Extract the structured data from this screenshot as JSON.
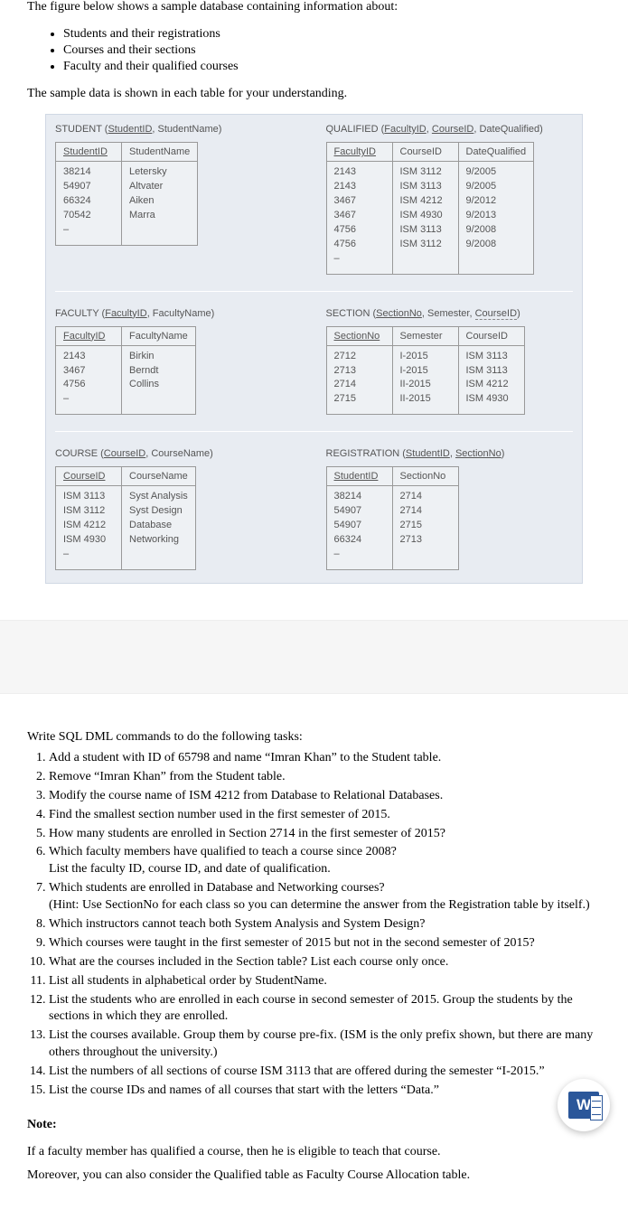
{
  "intro": "The figure below shows a sample database containing information about:",
  "bullets": [
    "Students and their registrations",
    "Courses and their sections",
    "Faculty and their qualified courses"
  ],
  "sample_line": "The sample data is shown in each table for your understanding.",
  "tables": {
    "student": {
      "title_prefix": "STUDENT (",
      "title_pk": "StudentID",
      "title_rest": ", StudentName)",
      "cols": [
        "StudentID",
        "StudentName"
      ],
      "rows": [
        [
          "38214",
          "Letersky"
        ],
        [
          "54907",
          "Altvater"
        ],
        [
          "66324",
          "Aiken"
        ],
        [
          "70542",
          "Marra"
        ],
        [
          "–",
          ""
        ]
      ]
    },
    "qualified": {
      "title_prefix": "QUALIFIED (",
      "title_pk1": "FacultyID",
      "title_sep": ", ",
      "title_pk2": "CourseID",
      "title_rest": ", DateQualified)",
      "cols": [
        "FacultyID",
        "CourseID",
        "DateQualified"
      ],
      "rows": [
        [
          "2143",
          "ISM 3112",
          "9/2005"
        ],
        [
          "2143",
          "ISM 3113",
          "9/2005"
        ],
        [
          "3467",
          "ISM 4212",
          "9/2012"
        ],
        [
          "3467",
          "ISM 4930",
          "9/2013"
        ],
        [
          "4756",
          "ISM 3113",
          "9/2008"
        ],
        [
          "4756",
          "ISM 3112",
          "9/2008"
        ],
        [
          "–",
          "",
          ""
        ]
      ]
    },
    "faculty": {
      "title_prefix": "FACULTY (",
      "title_pk": "FacultyID",
      "title_rest": ", FacultyName)",
      "cols": [
        "FacultyID",
        "FacultyName"
      ],
      "rows": [
        [
          "2143",
          "Birkin"
        ],
        [
          "3467",
          "Berndt"
        ],
        [
          "4756",
          "Collins"
        ],
        [
          "–",
          ""
        ]
      ]
    },
    "section": {
      "title_prefix": "SECTION (",
      "title_pk": "SectionNo",
      "title_mid": ", Semester, ",
      "title_fk": "CourseID",
      "title_rest": ")",
      "cols": [
        "SectionNo",
        "Semester",
        "CourseID"
      ],
      "rows": [
        [
          "2712",
          "I-2015",
          "ISM 3113"
        ],
        [
          "2713",
          "I-2015",
          "ISM 3113"
        ],
        [
          "2714",
          "II-2015",
          "ISM 4212"
        ],
        [
          "2715",
          "II-2015",
          "ISM 4930"
        ]
      ]
    },
    "course": {
      "title_prefix": "COURSE (",
      "title_pk": "CourseID",
      "title_rest": ", CourseName)",
      "cols": [
        "CourseID",
        "CourseName"
      ],
      "rows": [
        [
          "ISM 3113",
          "Syst Analysis"
        ],
        [
          "ISM 3112",
          "Syst Design"
        ],
        [
          "ISM 4212",
          "Database"
        ],
        [
          "ISM 4930",
          "Networking"
        ],
        [
          "–",
          ""
        ]
      ]
    },
    "registration": {
      "title_prefix": "REGISTRATION (",
      "title_pk1": "StudentID",
      "title_sep": ", ",
      "title_pk2": "SectionNo",
      "title_rest": ")",
      "cols": [
        "StudentID",
        "SectionNo"
      ],
      "rows": [
        [
          "38214",
          "2714"
        ],
        [
          "54907",
          "2714"
        ],
        [
          "54907",
          "2715"
        ],
        [
          "66324",
          "2713"
        ],
        [
          "–",
          ""
        ]
      ]
    }
  },
  "tasks_intro": "Write SQL DML commands to do the following tasks:",
  "tasks": [
    "Add a student with ID of 65798 and name “Imran Khan” to the Student table.",
    "Remove “Imran Khan” from the Student table.",
    "Modify the course name of ISM 4212 from Database to Relational Databases.",
    "Find the smallest section number used in the first semester of 2015.",
    "How many students are enrolled in Section 2714 in the first semester of 2015?",
    "Which faculty members have qualified to teach a course since 2008?\nList the faculty ID, course ID, and date of qualification.",
    "Which students are enrolled in Database and Networking courses?\n(Hint: Use SectionNo for each class so you can determine the answer from the Registration table by itself.)",
    "Which instructors cannot teach both System Analysis and System Design?",
    "Which courses were taught in the first semester of 2015 but not in the second semester of 2015?",
    "What are the courses included in the Section table? List each course only once.",
    "List all students in alphabetical order by StudentName.",
    "List the students who are enrolled in each course in second semester of 2015. Group the students by the sections in which they are enrolled.",
    "List the courses available. Group them by course pre-fix. (ISM is the only prefix shown, but there are many others throughout the university.)",
    "List the numbers of all sections of course ISM 3113 that are offered during the semester “I-2015.”",
    "List the course IDs and names of all courses that start with the letters “Data.”"
  ],
  "note_heading": "Note:",
  "note_p1": "If a faculty member has qualified a course, then he is eligible to teach that course.",
  "note_p2": "Moreover, you can also consider the Qualified table as Faculty Course Allocation table.",
  "word_badge_letter": "W"
}
